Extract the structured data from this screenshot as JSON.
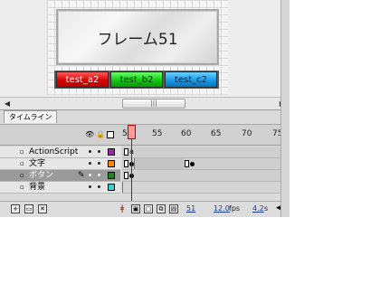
{
  "stage": {
    "frame_title": "フレーム51",
    "buttons": [
      {
        "label": "test_a2",
        "color": "#d40000"
      },
      {
        "label": "test_b2",
        "color": "#12c812"
      },
      {
        "label": "test_c2",
        "color": "#1a9ae6"
      }
    ],
    "scrollbar_thumb": "|||"
  },
  "timeline": {
    "tab_label": "タイムライン",
    "ruler_ticks": [
      "50",
      "55",
      "60",
      "65",
      "70",
      "75"
    ],
    "current_frame": "51",
    "frame_rate": "12.0",
    "frame_rate_unit": "fps",
    "elapsed_time": "4.2",
    "elapsed_unit": "s",
    "layers": [
      {
        "name": "ActionScript",
        "swatch": "#9a2aa8",
        "selected": false
      },
      {
        "name": "文字",
        "swatch": "#ff8a00",
        "selected": false
      },
      {
        "name": "ボタン",
        "swatch": "#1a8a1a",
        "selected": true
      },
      {
        "name": "背景",
        "swatch": "#3ad0d0",
        "selected": false
      }
    ]
  }
}
